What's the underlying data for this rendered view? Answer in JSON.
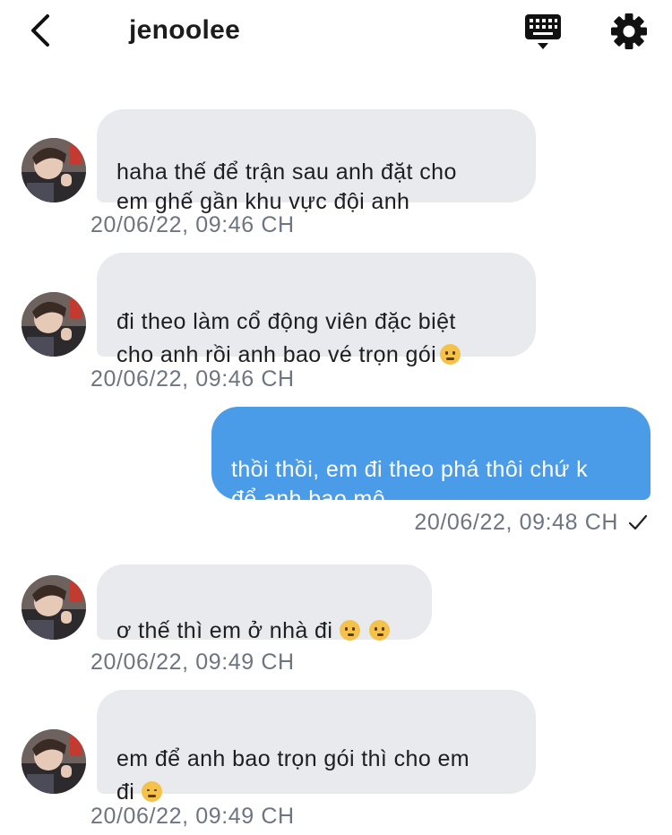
{
  "header": {
    "title": "jenoolee",
    "back_icon": "chevron-left-icon",
    "keyboard_icon": "keyboard-icon",
    "settings_icon": "gear-icon"
  },
  "colors": {
    "incoming_bubble": "#e8eaee",
    "outgoing_bubble": "#4a9be8",
    "timestamp": "#6d7581"
  },
  "messages": [
    {
      "direction": "incoming",
      "text": "haha thế để trận sau anh đặt cho\nem ghế gần khu vực đội anh",
      "emoji": "",
      "time": "20/06/22, 09:46 CH"
    },
    {
      "direction": "incoming",
      "text": "đi theo làm cổ động viên đặc biệt\ncho anh rồi anh bao vé trọn gói",
      "emoji": "sneezing-face-emoji",
      "time": "20/06/22, 09:46 CH"
    },
    {
      "direction": "outgoing",
      "text": "thồi thồi, em đi theo phá thôi chứ k\nđể anh bao mô",
      "emoji": "",
      "time": "20/06/22, 09:48 CH",
      "status_icon": "checkmark-icon"
    },
    {
      "direction": "incoming",
      "text": "ơ thế thì em ở nhà đi",
      "emoji": "thinking-face-emoji x2",
      "time": "20/06/22, 09:49 CH"
    },
    {
      "direction": "incoming",
      "text": "em để anh bao trọn gói thì cho em\nđi",
      "emoji": "drooling-face-emoji",
      "time": "20/06/22, 09:49 CH"
    }
  ]
}
